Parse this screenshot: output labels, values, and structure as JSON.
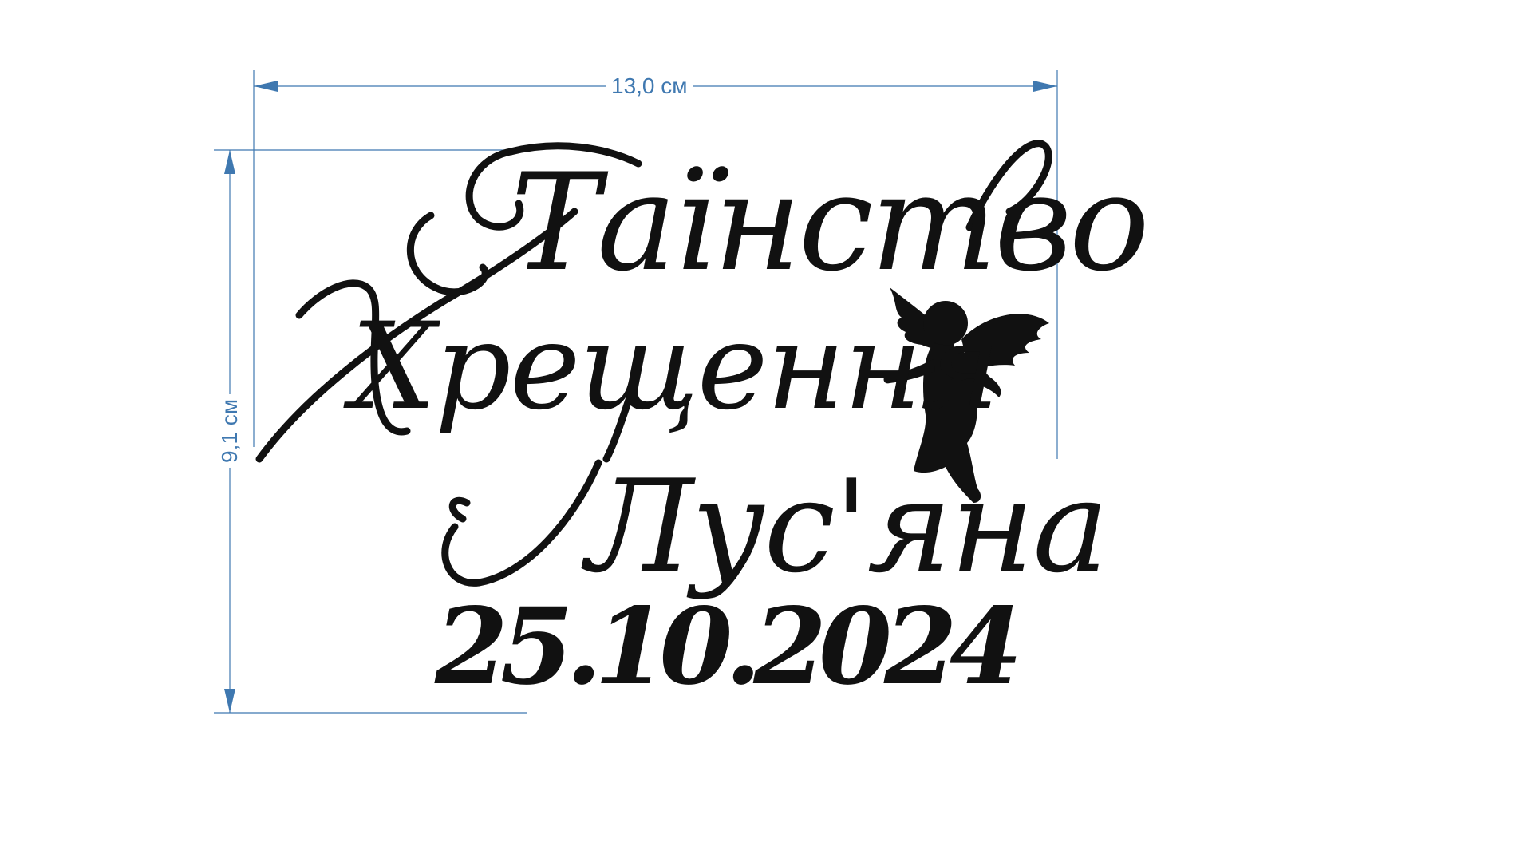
{
  "dimensions": {
    "width_label": "13,0 см",
    "height_label": "9,1 см"
  },
  "inscription": {
    "line1": "Таїнство",
    "line2": "Хрещення",
    "line3": "Лус'яна",
    "date": "25.10.2024"
  },
  "decoration": {
    "icon": "angel-silhouette-icon"
  },
  "colors": {
    "dimension_lines": "#3f78b0",
    "ink": "#111111",
    "background": "#ffffff"
  }
}
